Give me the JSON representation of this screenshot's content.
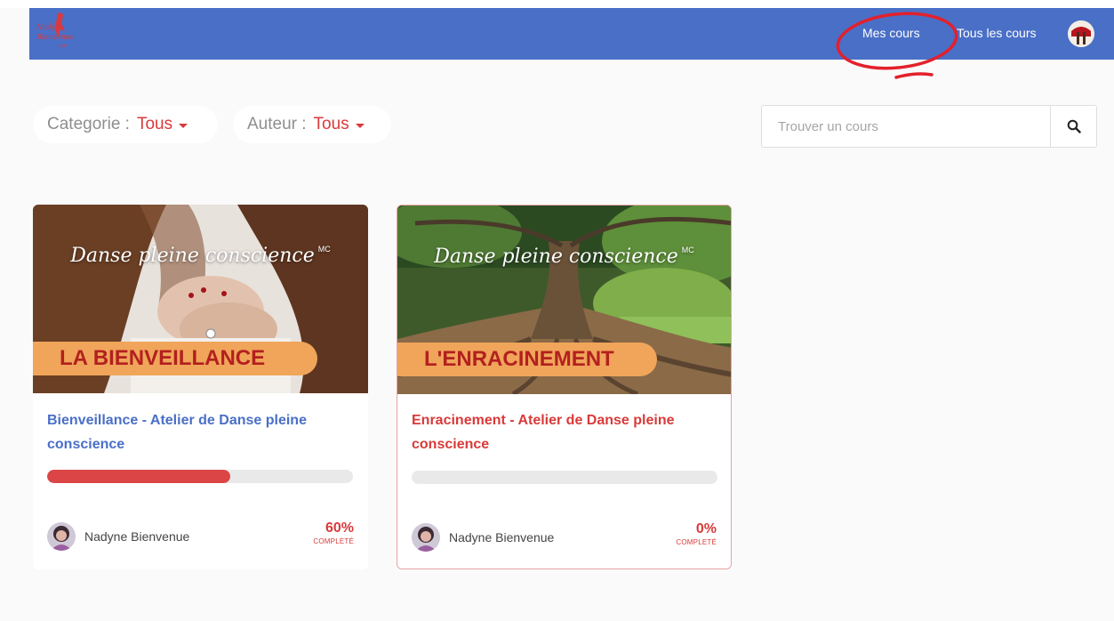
{
  "nav": {
    "logo_alt": "Nadyne Bienvenue",
    "mes_cours": "Mes cours",
    "tous_les_cours": "Tous les cours"
  },
  "filters": {
    "categorie_label": "Categorie :",
    "categorie_value": "Tous",
    "auteur_label": "Auteur :",
    "auteur_value": "Tous"
  },
  "search": {
    "placeholder": "Trouver un cours"
  },
  "courses": [
    {
      "image_script": "Danse pleine conscience",
      "image_mark": "MC",
      "image_banner": "LA BIENVEILLANCE",
      "title": "Bienveillance - Atelier de Danse pleine conscience",
      "progress": 0.6,
      "author": "Nadyne Bienvenue",
      "percent": "60%",
      "percent_label": "COMPLETÉ"
    },
    {
      "image_script": "Danse pleine conscience",
      "image_mark": "MC",
      "image_banner": "L'ENRACINEMENT",
      "title": "Enracinement - Atelier de Danse pleine conscience",
      "progress": 0,
      "author": "Nadyne Bienvenue",
      "percent": "0%",
      "percent_label": "COMPLETÉ"
    }
  ],
  "colors": {
    "topbar": "#4a6fc7",
    "accent_red": "#d93a3a",
    "banner_orange": "#f0a55a"
  }
}
